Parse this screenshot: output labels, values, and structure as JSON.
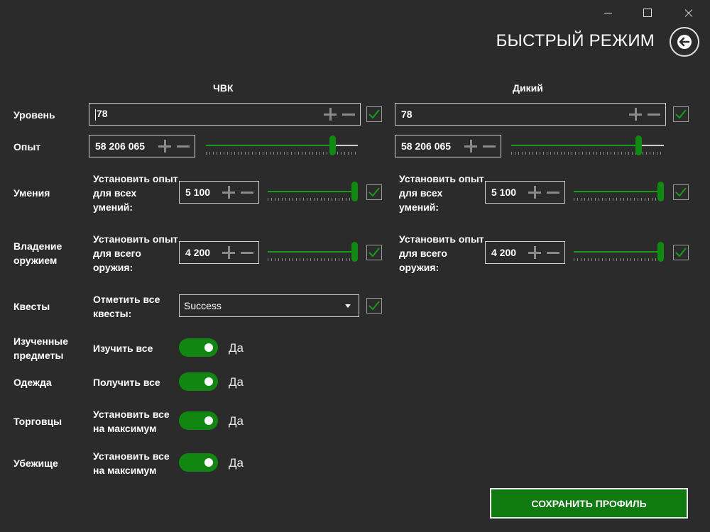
{
  "window": {
    "title": "БЫСТРЫЙ РЕЖИМ"
  },
  "columns": {
    "pmc": "ЧВК",
    "scav": "Дикий"
  },
  "rows": {
    "level": "Уровень",
    "experience": "Опыт",
    "skills": "Умения",
    "weapons": "Владение оружием",
    "quests": "Квесты",
    "examined": "Изученные предметы",
    "clothing": "Одежда",
    "traders": "Торговцы",
    "hideout": "Убежище"
  },
  "pmc": {
    "level": "78",
    "experience": "58 206 065",
    "skills_label": "Установить опыт для всех умений:",
    "skills_value": "5 100",
    "weapons_label": "Установить опыт для всего оружия:",
    "weapons_value": "4 200",
    "quests_label": "Отметить все квесты:",
    "quests_value": "Success",
    "examined_label": "Изучить все",
    "clothing_label": "Получить все",
    "traders_label": "Установить все на максимум",
    "hideout_label": "Установить все на максимум",
    "experience_slider": 0.85,
    "skills_slider": 1.0,
    "weapons_slider": 1.0
  },
  "scav": {
    "level": "78",
    "experience": "58 206 065",
    "skills_label": "Установить опыт для всех умений:",
    "skills_value": "5 100",
    "weapons_label": "Установить опыт для всего оружия:",
    "weapons_value": "4 200",
    "experience_slider": 0.85,
    "skills_slider": 1.0,
    "weapons_slider": 1.0
  },
  "toggles": {
    "on_text": "Да"
  },
  "save_button": "СОХРАНИТЬ ПРОФИЛЬ",
  "colors": {
    "background": "#2b2b2b",
    "accent": "#0f7a0f",
    "check": "#1a9a1a"
  }
}
